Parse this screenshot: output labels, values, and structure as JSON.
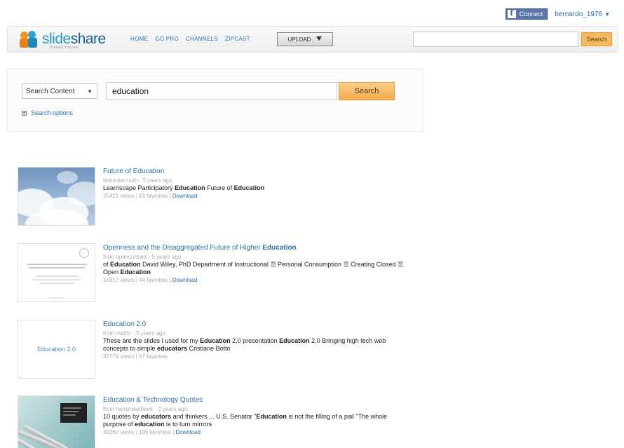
{
  "account": {
    "facebook_label": "Connect",
    "user_label": "bernardo_1976",
    "colors": {
      "facebook": "#3b5998"
    }
  },
  "header": {
    "logo": {
      "part1": "slide",
      "part2": "share",
      "tagline": "Present Yourself"
    },
    "nav": [
      {
        "label": "HOME"
      },
      {
        "label": "GO PRO"
      },
      {
        "label": "CHANNELS"
      },
      {
        "label": "ZIPCAST"
      }
    ],
    "upload_label": "UPLOAD",
    "search": {
      "value": "",
      "button_label": "Search"
    },
    "colors": {
      "accent_orange": "#f6a94b",
      "link_blue": "#2a6fb0"
    }
  },
  "search_panel": {
    "scope_label": "Search Content",
    "query": "education",
    "button_label": "Search",
    "options_label": "Search options"
  },
  "results": [
    {
      "title": "Future of Education",
      "author_line": "fedundermoth · 5 years ago",
      "desc_parts": [
        {
          "t": "Learnscape Participatory ",
          "b": false
        },
        {
          "t": "Education",
          "b": true
        },
        {
          "t": " Future of ",
          "b": false
        },
        {
          "t": "Education",
          "b": true
        }
      ],
      "stats": "35421 views | 83 favorites | ",
      "download_label": "Download"
    },
    {
      "title_parts": [
        {
          "t": "Openness and the Disaggregated Future of Higher ",
          "b": false
        },
        {
          "t": "Education",
          "b": true
        }
      ],
      "author_line": "from opencontent · 5 years ago",
      "desc_parts": [
        {
          "t": "of ",
          "b": false
        },
        {
          "t": "Education",
          "b": true
        },
        {
          "t": " David Wiley, PhD Department of Instructional ☰ Personal Consumption ☰ Creating Closed ☰ Open ",
          "b": false
        },
        {
          "t": "Education",
          "b": true
        }
      ],
      "stats": "15917 views | 44 favorites | ",
      "download_label": "Download",
      "thumb_title": "Openness and the Disaggregated Future of Higher Education"
    },
    {
      "title": "Education 2.0",
      "author_line": "from mattfc · 5 years ago",
      "desc_parts": [
        {
          "t": "These are the slides I used for my ",
          "b": false
        },
        {
          "t": "Education",
          "b": true
        },
        {
          "t": " 2.0 presentation ",
          "b": false
        },
        {
          "t": "Education",
          "b": true
        },
        {
          "t": " 2.0 Bringing high tech web concepts to simple ",
          "b": false
        },
        {
          "t": "educators",
          "b": true
        },
        {
          "t": " Cristiane Botto",
          "b": false
        }
      ],
      "stats": "32774 views | 67 favorites",
      "thumb_text": "Education 2.0"
    },
    {
      "title": "Education & Technology Quotes",
      "author_line": "from hansmeerbeek · 2 years ago",
      "desc_parts": [
        {
          "t": "10 quotes by ",
          "b": false
        },
        {
          "t": "educators",
          "b": true
        },
        {
          "t": " and thinkers ... U.S. Senator \"",
          "b": false
        },
        {
          "t": "Education",
          "b": true
        },
        {
          "t": " is not the filling of a pail \"The whole purpose of ",
          "b": false
        },
        {
          "t": "education",
          "b": true
        },
        {
          "t": " is to turn mirrors",
          "b": false
        }
      ],
      "stats": "40260 views | 106 favorites | ",
      "download_label": "Download"
    }
  ]
}
